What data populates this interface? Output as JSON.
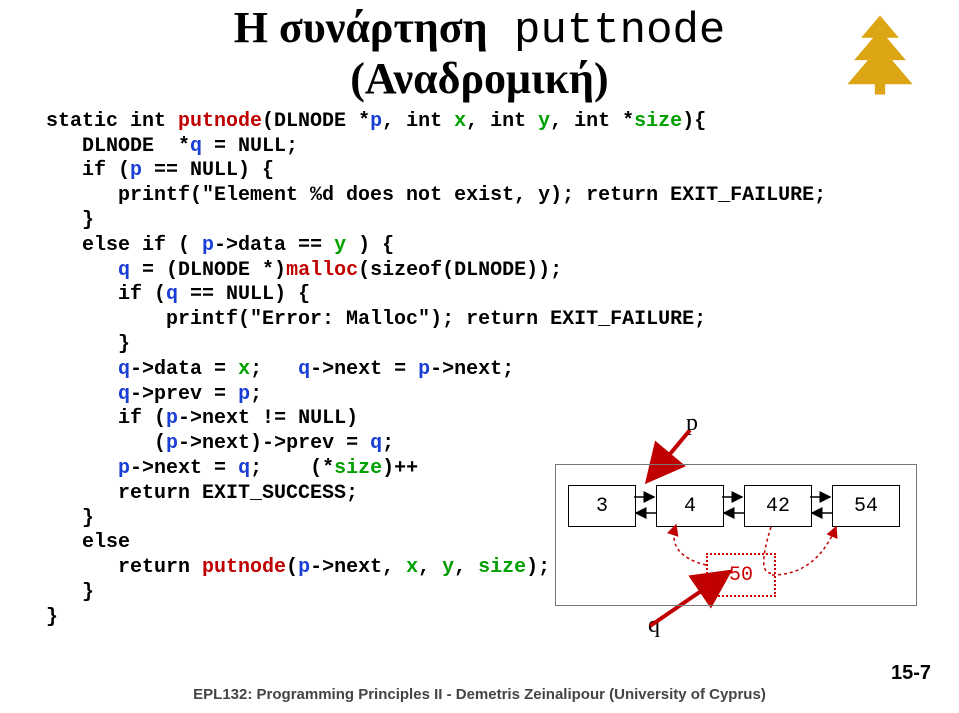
{
  "title": {
    "line1_black": "Η συνάρτηση",
    "line1_mono": " puttnode",
    "line2": "(Αναδρομική)"
  },
  "code": {
    "l1a": "static int ",
    "l1b": "putnode",
    "l1c": "(DLNODE *",
    "l1d": "p",
    "l1e": ", int ",
    "l1f": "x",
    "l1g": ", int ",
    "l1h": "y",
    "l1i": ", int *",
    "l1j": "size",
    "l1k": "){",
    "l2a": "   DLNODE  *",
    "l2b": "q",
    "l2c": " = NULL;",
    "l3a": "   if (",
    "l3b": "p",
    "l3c": " == NULL) {",
    "l4": "      printf(\"Element %d does not exist, y); return EXIT_FAILURE;",
    "l5": "   }",
    "l6a": "   else if ( ",
    "l6b": "p",
    "l6c": "->data == ",
    "l6d": "y",
    "l6e": " ) {",
    "l7a": "      ",
    "l7b": "q",
    "l7c": " = (DLNODE *)",
    "l7d": "malloc",
    "l7e": "(sizeof(DLNODE));",
    "l8a": "      if (",
    "l8b": "q",
    "l8c": " == NULL) {",
    "l9": "          printf(\"Error: Malloc\"); return EXIT_FAILURE;",
    "l10": "      }",
    "l11a": "      ",
    "l11b": "q",
    "l11c": "->data = ",
    "l11d": "x",
    "l11e": ";   ",
    "l11f": "q",
    "l11g": "->next = ",
    "l11h": "p",
    "l11i": "->next;",
    "l12a": "      ",
    "l12b": "q",
    "l12c": "->prev = ",
    "l12d": "p",
    "l12e": ";",
    "l13a": "      if (",
    "l13b": "p",
    "l13c": "->next != NULL)",
    "l14a": "         (",
    "l14b": "p",
    "l14c": "->next)->prev = ",
    "l14d": "q",
    "l14e": ";",
    "l15a": "      ",
    "l15b": "p",
    "l15c": "->next = ",
    "l15d": "q",
    "l15e": ";    (*",
    "l15f": "size",
    "l15g": ")++",
    "l16": "      return EXIT_SUCCESS;",
    "l17": "   }",
    "l18": "   else",
    "l19a": "      return ",
    "l19b": "putnode",
    "l19c": "(",
    "l19d": "p",
    "l19e": "->next, ",
    "l19f": "x",
    "l19g": ", ",
    "l19h": "y",
    "l19i": ", ",
    "l19j": "size",
    "l19k": ");",
    "l20": "   }",
    "l21": "}"
  },
  "diagram": {
    "n1": "3",
    "n2": "4",
    "n3": "42",
    "n4": "54",
    "n5": "50",
    "p_label": "p",
    "q_label": "q"
  },
  "footer": "EPL132: Programming Principles II - Demetris Zeinalipour (University of Cyprus)",
  "pagenum": "15-7"
}
